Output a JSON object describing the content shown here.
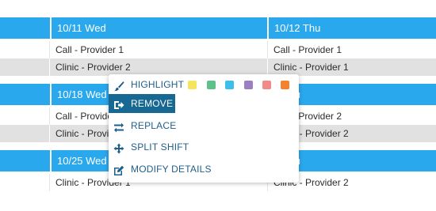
{
  "colors": {
    "header_bg": "#2aa8ee",
    "alt_row_bg": "#e1e1e1",
    "menu_text": "#1f5f8b",
    "menu_active_bg": "#176893"
  },
  "weeks": [
    {
      "days": [
        "",
        "10/11 Wed",
        "10/12 Thu"
      ],
      "rows": [
        [
          "",
          "Call - Provider 1",
          "Call - Provider 1"
        ],
        [
          "",
          "Clinic - Provider 2",
          "Clinic - Provider 1"
        ]
      ]
    },
    {
      "days": [
        "",
        "10/18 Wed",
        "9 Thu"
      ],
      "rows": [
        [
          "",
          "Call - Provider 2",
          "Call - Provider 2"
        ],
        [
          "",
          "Clinic - Provider 1",
          "Clinic - Provider 2"
        ]
      ]
    },
    {
      "days": [
        "",
        "10/25 Wed",
        "6 Thu"
      ],
      "rows": [
        [
          "",
          "Clinic - Provider 1",
          "Clinic - Provider 2"
        ]
      ]
    }
  ],
  "context_menu": {
    "highlight": {
      "label": "HIGHLIGHT",
      "icon": "brush-icon",
      "swatches": [
        "#f6e45c",
        "#5fc08a",
        "#3cbfea",
        "#9a7fc1",
        "#f28a8a",
        "#f4832d"
      ]
    },
    "remove": {
      "label": "REMOVE",
      "icon": "remove-icon"
    },
    "replace": {
      "label": "REPLACE",
      "icon": "swap-icon"
    },
    "split_shift": {
      "label": "SPLIT SHIFT",
      "icon": "move-arrows-icon"
    },
    "modify_details": {
      "label": "MODIFY DETAILS",
      "icon": "edit-icon"
    }
  }
}
